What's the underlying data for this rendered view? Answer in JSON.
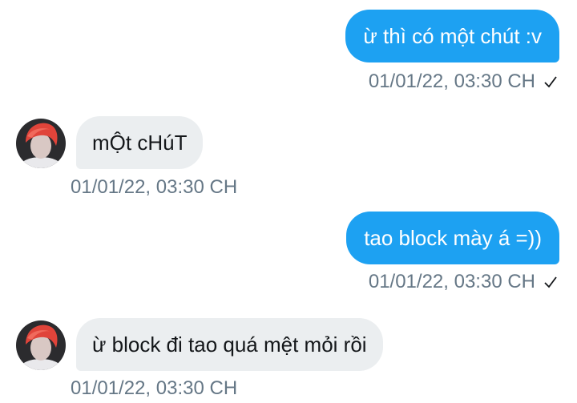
{
  "conversation": {
    "messages": [
      {
        "direction": "sent",
        "text": "ừ thì có một chút :v",
        "timestamp": "01/01/22, 03:30 CH",
        "status_icon": "check-icon"
      },
      {
        "direction": "received",
        "text": "mỘt cHúT",
        "timestamp": "01/01/22, 03:30 CH",
        "avatar_icon": "red-hair-avatar"
      },
      {
        "direction": "sent",
        "text": "tao block mày á =))",
        "timestamp": "01/01/22, 03:30 CH",
        "status_icon": "check-icon"
      },
      {
        "direction": "received",
        "text": "ừ block đi tao quá mệt mỏi rồi",
        "timestamp": "01/01/22, 03:30 CH",
        "avatar_icon": "red-hair-avatar"
      }
    ]
  },
  "colors": {
    "sent_bubble": "#1da1f2",
    "received_bubble": "#ebeef0",
    "timestamp_text": "#657786"
  }
}
